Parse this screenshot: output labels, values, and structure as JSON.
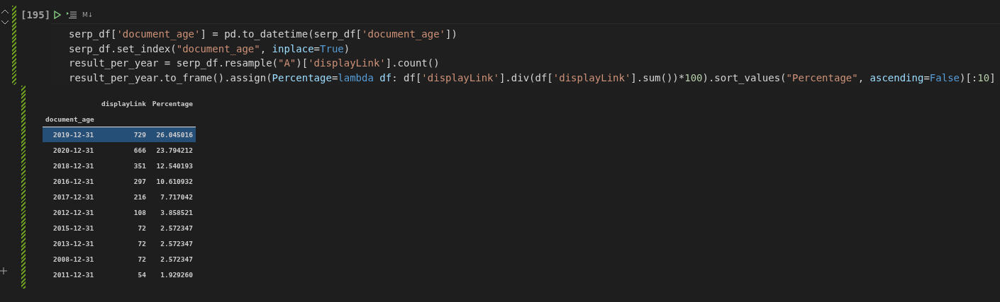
{
  "cell": {
    "execution_count": "[195]",
    "toolbar_label": "M↓",
    "code": [
      [
        {
          "kind": "plain",
          "text": "serp_df["
        },
        {
          "kind": "string",
          "text": "'document_age'"
        },
        {
          "kind": "plain",
          "text": "] = pd.to_datetime(serp_df["
        },
        {
          "kind": "string",
          "text": "'document_age'"
        },
        {
          "kind": "plain",
          "text": "])"
        }
      ],
      [
        {
          "kind": "plain",
          "text": "serp_df.set_index("
        },
        {
          "kind": "string",
          "text": "\"document_age\""
        },
        {
          "kind": "plain",
          "text": ", "
        },
        {
          "kind": "param",
          "text": "inplace"
        },
        {
          "kind": "plain",
          "text": "="
        },
        {
          "kind": "keyword",
          "text": "True"
        },
        {
          "kind": "plain",
          "text": ")"
        }
      ],
      [
        {
          "kind": "plain",
          "text": "result_per_year = serp_df.resample("
        },
        {
          "kind": "string",
          "text": "\"A\""
        },
        {
          "kind": "plain",
          "text": ")["
        },
        {
          "kind": "string",
          "text": "'displayLink'"
        },
        {
          "kind": "plain",
          "text": "].count()"
        }
      ],
      [
        {
          "kind": "plain",
          "text": "result_per_year.to_frame().assign("
        },
        {
          "kind": "param",
          "text": "Percentage"
        },
        {
          "kind": "plain",
          "text": "="
        },
        {
          "kind": "keyword",
          "text": "lambda"
        },
        {
          "kind": "param",
          "text": " df"
        },
        {
          "kind": "plain",
          "text": ": df["
        },
        {
          "kind": "string",
          "text": "'displayLink'"
        },
        {
          "kind": "plain",
          "text": "].div(df["
        },
        {
          "kind": "string",
          "text": "'displayLink'"
        },
        {
          "kind": "plain",
          "text": "].sum())*"
        },
        {
          "kind": "number",
          "text": "100"
        },
        {
          "kind": "plain",
          "text": ").sort_values("
        },
        {
          "kind": "string",
          "text": "\"Percentage\""
        },
        {
          "kind": "plain",
          "text": ", "
        },
        {
          "kind": "param",
          "text": "ascending"
        },
        {
          "kind": "plain",
          "text": "="
        },
        {
          "kind": "keyword",
          "text": "False"
        },
        {
          "kind": "plain",
          "text": ")[:"
        },
        {
          "kind": "number",
          "text": "10"
        },
        {
          "kind": "plain",
          "text": "]"
        }
      ]
    ]
  },
  "output": {
    "columns": [
      "displayLink",
      "Percentage"
    ],
    "index_name": "document_age",
    "rows": [
      {
        "index": "2019-12-31",
        "values": [
          "729",
          "26.045016"
        ],
        "selected": true
      },
      {
        "index": "2020-12-31",
        "values": [
          "666",
          "23.794212"
        ],
        "selected": false
      },
      {
        "index": "2018-12-31",
        "values": [
          "351",
          "12.540193"
        ],
        "selected": false
      },
      {
        "index": "2016-12-31",
        "values": [
          "297",
          "10.610932"
        ],
        "selected": false
      },
      {
        "index": "2017-12-31",
        "values": [
          "216",
          "7.717042"
        ],
        "selected": false
      },
      {
        "index": "2012-12-31",
        "values": [
          "108",
          "3.858521"
        ],
        "selected": false
      },
      {
        "index": "2015-12-31",
        "values": [
          "72",
          "2.572347"
        ],
        "selected": false
      },
      {
        "index": "2013-12-31",
        "values": [
          "72",
          "2.572347"
        ],
        "selected": false
      },
      {
        "index": "2008-12-31",
        "values": [
          "72",
          "2.572347"
        ],
        "selected": false
      },
      {
        "index": "2011-12-31",
        "values": [
          "54",
          "1.929260"
        ],
        "selected": false
      }
    ]
  }
}
